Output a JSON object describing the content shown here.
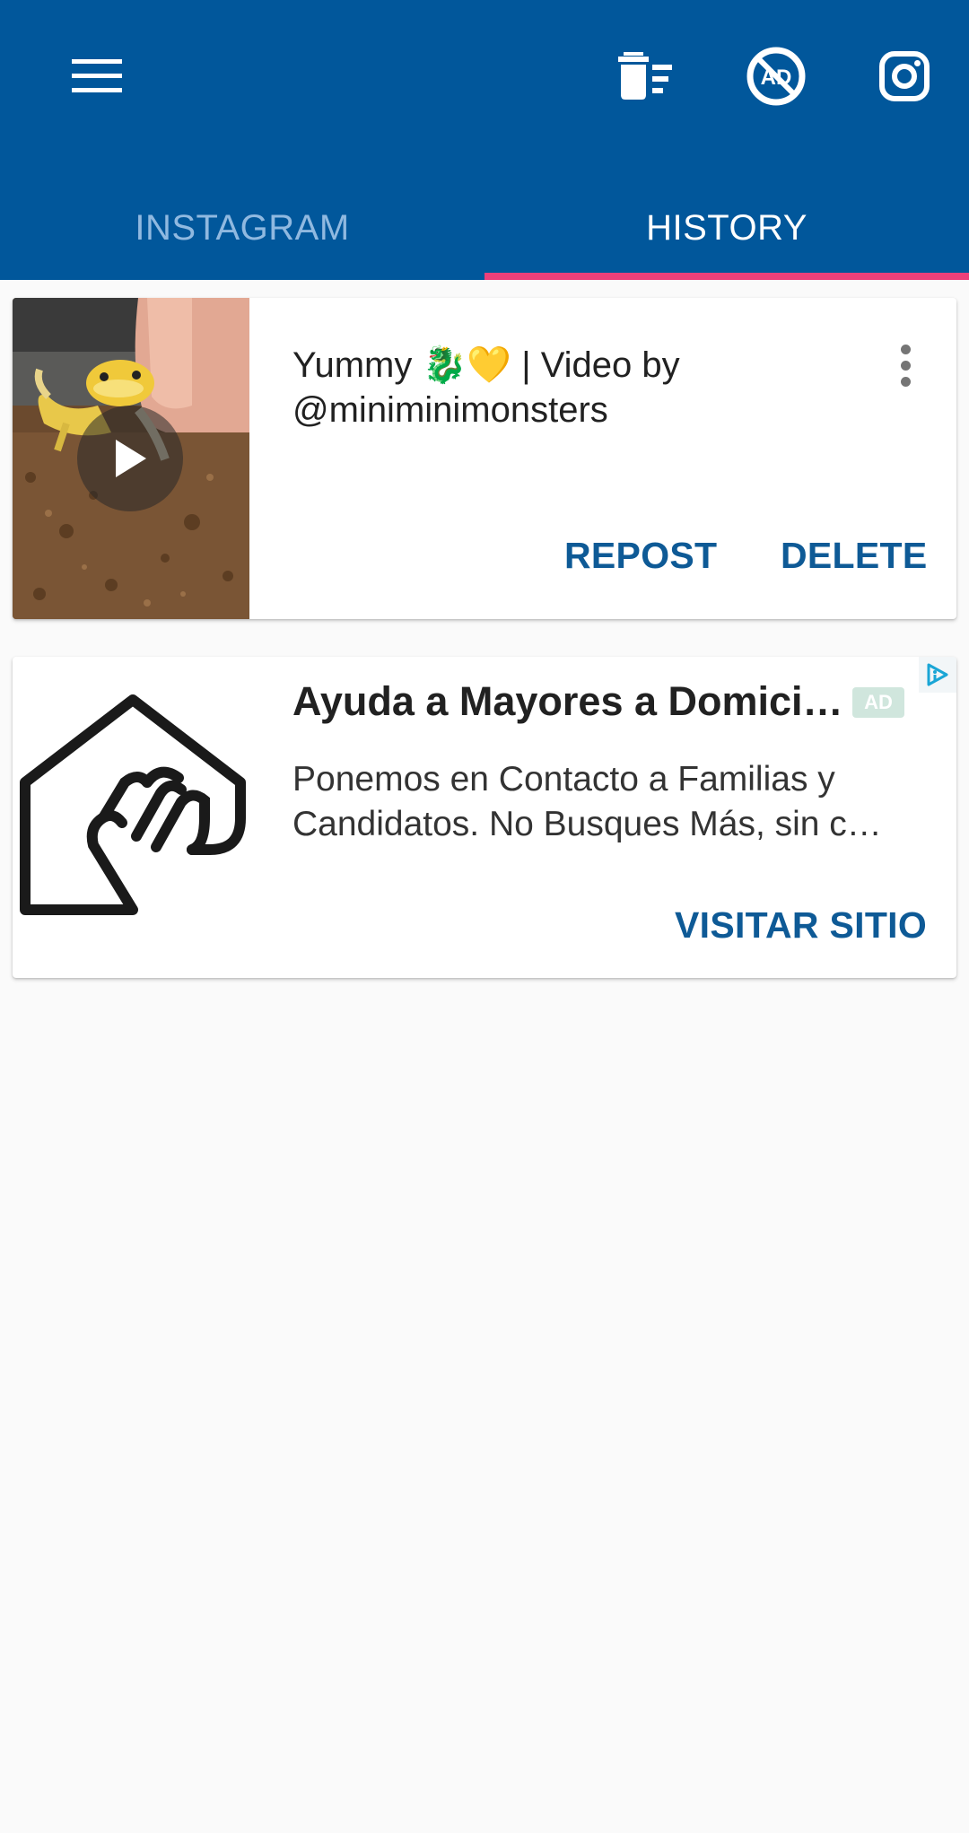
{
  "toolbar": {
    "menu_icon": "hamburger-menu-icon",
    "clear_icon": "clear-history-icon",
    "noads_icon": "remove-ads-icon",
    "instagram_icon": "instagram-icon"
  },
  "tabs": [
    {
      "label": "INSTAGRAM",
      "active": false
    },
    {
      "label": "HISTORY",
      "active": true
    }
  ],
  "history": {
    "items": [
      {
        "title": "Yummy 🐉💛 | Video by @miniminimonsters",
        "media_type": "video",
        "actions": {
          "repost": "REPOST",
          "delete": "DELETE"
        }
      }
    ]
  },
  "ad": {
    "title": "Ayuda a Mayores a Domicilio",
    "badge": "AD",
    "body": "Ponemos en Contacto a Familias y Candidatos. No Busques Más, sin c…",
    "cta": "VISITAR SITIO"
  },
  "colors": {
    "primary": "#01579b",
    "accent": "#ec407a",
    "action_text": "#0e5a96",
    "background": "#fafafa"
  }
}
